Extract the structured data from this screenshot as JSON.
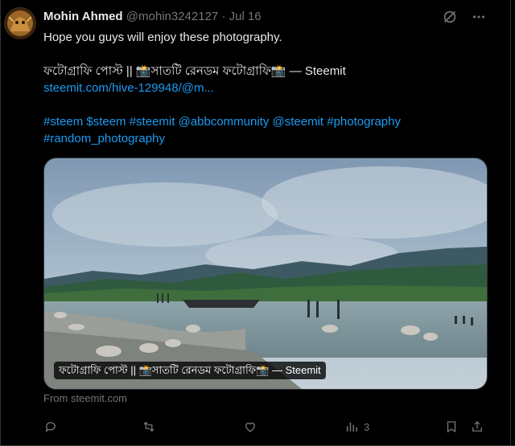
{
  "tweet": {
    "author_name": "Mohin Ahmed",
    "author_handle": "@mohin3242127",
    "separator": "·",
    "date": "Jul 16",
    "text_line1": "Hope you guys will enjoy these photography.",
    "text_title": "ফটোগ্রাফি পোস্ট || 📸সাতটি রেনডম ফটোগ্রাফি📸 — Steemit",
    "link_url": "steemit.com/hive-129948/@m...",
    "hashtags_line1": "#steem $steem #steemit @abbcommunity @steemit #photography",
    "hashtags_line2": "#random_photography",
    "card_caption": "ফটোগ্রাফি পোস্ট || 📸সাতটি রেনডম ফটোগ্রাফি📸 — Steemit",
    "from_text": "From steemit.com",
    "views_count": "3"
  },
  "colors": {
    "background": "#000000",
    "text": "#e7e9ea",
    "muted": "#71767b",
    "link": "#1d9bf0",
    "border": "#2f3336"
  },
  "icons": {
    "header": [
      "grok-slash-icon",
      "more-options-icon"
    ],
    "actions": [
      "reply-icon",
      "retweet-icon",
      "like-icon",
      "views-icon",
      "bookmark-icon",
      "share-icon"
    ]
  }
}
